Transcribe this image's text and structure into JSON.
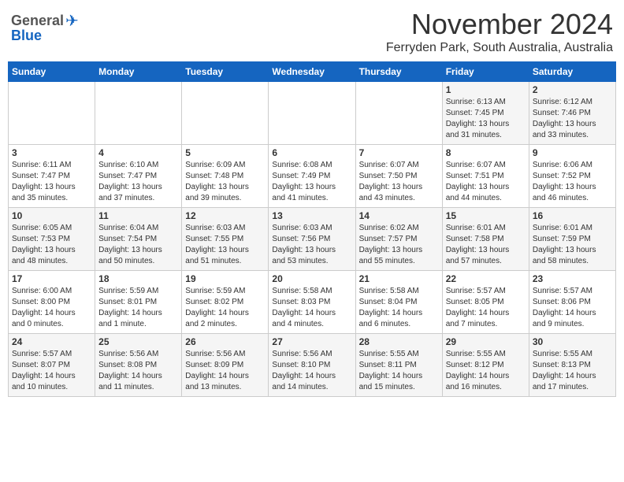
{
  "logo": {
    "general": "General",
    "blue": "Blue"
  },
  "title": "November 2024",
  "location": "Ferryden Park, South Australia, Australia",
  "days_header": [
    "Sunday",
    "Monday",
    "Tuesday",
    "Wednesday",
    "Thursday",
    "Friday",
    "Saturday"
  ],
  "weeks": [
    [
      {
        "day": "",
        "info": ""
      },
      {
        "day": "",
        "info": ""
      },
      {
        "day": "",
        "info": ""
      },
      {
        "day": "",
        "info": ""
      },
      {
        "day": "",
        "info": ""
      },
      {
        "day": "1",
        "info": "Sunrise: 6:13 AM\nSunset: 7:45 PM\nDaylight: 13 hours\nand 31 minutes."
      },
      {
        "day": "2",
        "info": "Sunrise: 6:12 AM\nSunset: 7:46 PM\nDaylight: 13 hours\nand 33 minutes."
      }
    ],
    [
      {
        "day": "3",
        "info": "Sunrise: 6:11 AM\nSunset: 7:47 PM\nDaylight: 13 hours\nand 35 minutes."
      },
      {
        "day": "4",
        "info": "Sunrise: 6:10 AM\nSunset: 7:47 PM\nDaylight: 13 hours\nand 37 minutes."
      },
      {
        "day": "5",
        "info": "Sunrise: 6:09 AM\nSunset: 7:48 PM\nDaylight: 13 hours\nand 39 minutes."
      },
      {
        "day": "6",
        "info": "Sunrise: 6:08 AM\nSunset: 7:49 PM\nDaylight: 13 hours\nand 41 minutes."
      },
      {
        "day": "7",
        "info": "Sunrise: 6:07 AM\nSunset: 7:50 PM\nDaylight: 13 hours\nand 43 minutes."
      },
      {
        "day": "8",
        "info": "Sunrise: 6:07 AM\nSunset: 7:51 PM\nDaylight: 13 hours\nand 44 minutes."
      },
      {
        "day": "9",
        "info": "Sunrise: 6:06 AM\nSunset: 7:52 PM\nDaylight: 13 hours\nand 46 minutes."
      }
    ],
    [
      {
        "day": "10",
        "info": "Sunrise: 6:05 AM\nSunset: 7:53 PM\nDaylight: 13 hours\nand 48 minutes."
      },
      {
        "day": "11",
        "info": "Sunrise: 6:04 AM\nSunset: 7:54 PM\nDaylight: 13 hours\nand 50 minutes."
      },
      {
        "day": "12",
        "info": "Sunrise: 6:03 AM\nSunset: 7:55 PM\nDaylight: 13 hours\nand 51 minutes."
      },
      {
        "day": "13",
        "info": "Sunrise: 6:03 AM\nSunset: 7:56 PM\nDaylight: 13 hours\nand 53 minutes."
      },
      {
        "day": "14",
        "info": "Sunrise: 6:02 AM\nSunset: 7:57 PM\nDaylight: 13 hours\nand 55 minutes."
      },
      {
        "day": "15",
        "info": "Sunrise: 6:01 AM\nSunset: 7:58 PM\nDaylight: 13 hours\nand 57 minutes."
      },
      {
        "day": "16",
        "info": "Sunrise: 6:01 AM\nSunset: 7:59 PM\nDaylight: 13 hours\nand 58 minutes."
      }
    ],
    [
      {
        "day": "17",
        "info": "Sunrise: 6:00 AM\nSunset: 8:00 PM\nDaylight: 14 hours\nand 0 minutes."
      },
      {
        "day": "18",
        "info": "Sunrise: 5:59 AM\nSunset: 8:01 PM\nDaylight: 14 hours\nand 1 minute."
      },
      {
        "day": "19",
        "info": "Sunrise: 5:59 AM\nSunset: 8:02 PM\nDaylight: 14 hours\nand 2 minutes."
      },
      {
        "day": "20",
        "info": "Sunrise: 5:58 AM\nSunset: 8:03 PM\nDaylight: 14 hours\nand 4 minutes."
      },
      {
        "day": "21",
        "info": "Sunrise: 5:58 AM\nSunset: 8:04 PM\nDaylight: 14 hours\nand 6 minutes."
      },
      {
        "day": "22",
        "info": "Sunrise: 5:57 AM\nSunset: 8:05 PM\nDaylight: 14 hours\nand 7 minutes."
      },
      {
        "day": "23",
        "info": "Sunrise: 5:57 AM\nSunset: 8:06 PM\nDaylight: 14 hours\nand 9 minutes."
      }
    ],
    [
      {
        "day": "24",
        "info": "Sunrise: 5:57 AM\nSunset: 8:07 PM\nDaylight: 14 hours\nand 10 minutes."
      },
      {
        "day": "25",
        "info": "Sunrise: 5:56 AM\nSunset: 8:08 PM\nDaylight: 14 hours\nand 11 minutes."
      },
      {
        "day": "26",
        "info": "Sunrise: 5:56 AM\nSunset: 8:09 PM\nDaylight: 14 hours\nand 13 minutes."
      },
      {
        "day": "27",
        "info": "Sunrise: 5:56 AM\nSunset: 8:10 PM\nDaylight: 14 hours\nand 14 minutes."
      },
      {
        "day": "28",
        "info": "Sunrise: 5:55 AM\nSunset: 8:11 PM\nDaylight: 14 hours\nand 15 minutes."
      },
      {
        "day": "29",
        "info": "Sunrise: 5:55 AM\nSunset: 8:12 PM\nDaylight: 14 hours\nand 16 minutes."
      },
      {
        "day": "30",
        "info": "Sunrise: 5:55 AM\nSunset: 8:13 PM\nDaylight: 14 hours\nand 17 minutes."
      }
    ]
  ]
}
